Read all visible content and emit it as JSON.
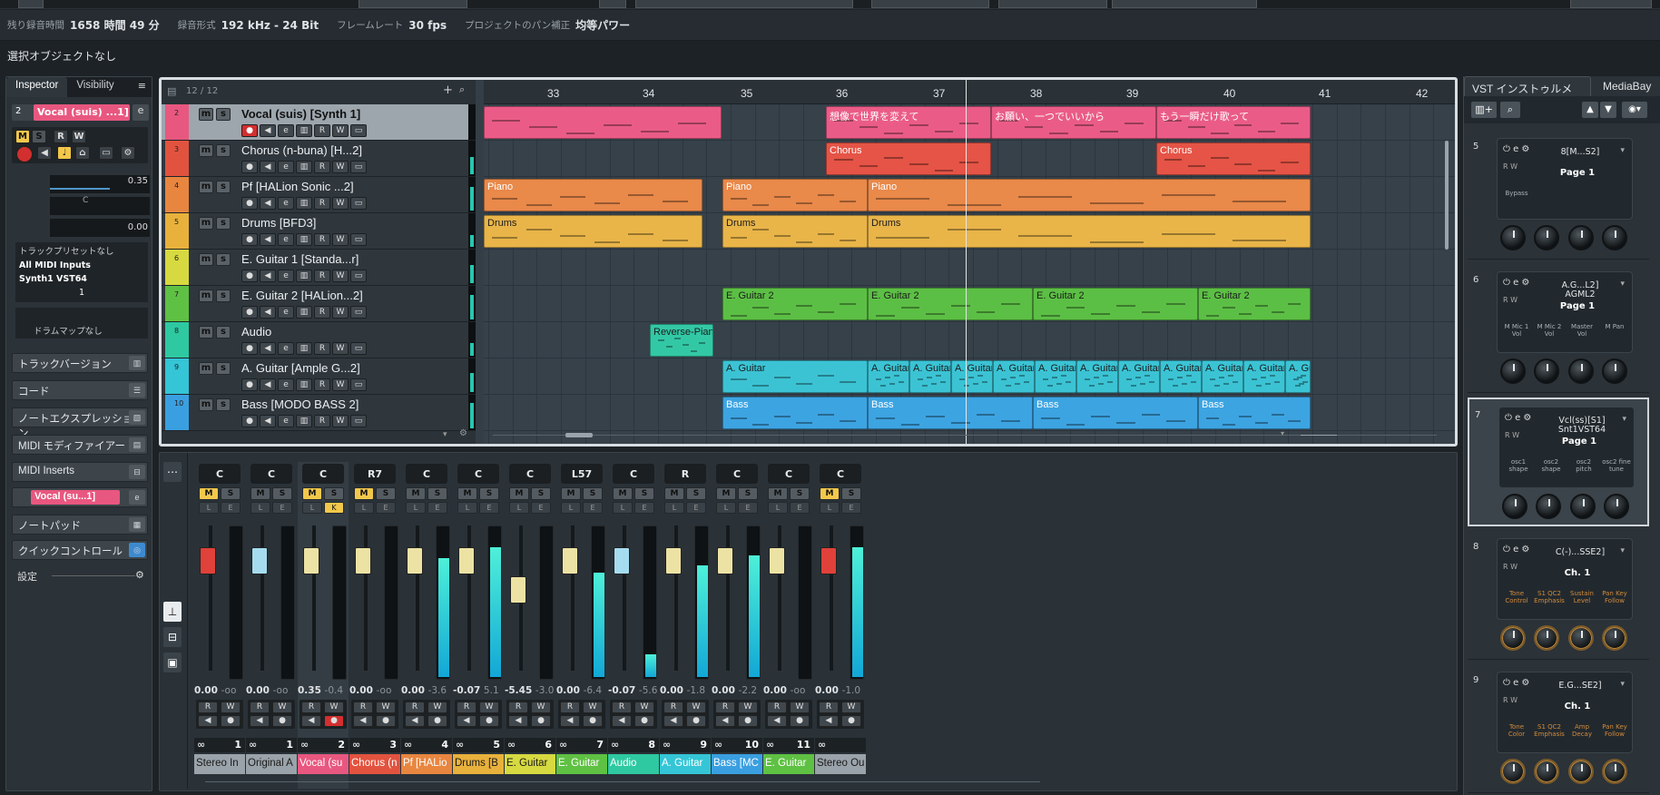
{
  "status": {
    "rec_time_label": "残り録音時間",
    "rec_time": "1658 時間 49 分",
    "rec_format_label": "録音形式",
    "rec_format": "192 kHz - 24 Bit",
    "frame_rate_label": "フレームレート",
    "frame_rate": "30 fps",
    "pan_label": "プロジェクトのパン補正",
    "pan_value": "均等パワー"
  },
  "selection_info": "選択オブジェクトなし",
  "inspector": {
    "tabs": [
      "Inspector",
      "Visibility"
    ],
    "track_name": "Vocal (suis) ...1]",
    "volume": "0.35",
    "pan": "C",
    "pan_val": "0.00",
    "preset": "トラックプリセットなし",
    "midi_in": "All MIDI Inputs",
    "midi_out": "Synth1 VST64",
    "channel": "1",
    "drum_map": "ドラムマップなし",
    "sections": [
      "トラックバージョン",
      "コード",
      "ノートエクスプレッション",
      "MIDI モディファイアー",
      "MIDI Inserts",
      "ノートパッド",
      "クイックコントロール"
    ],
    "sel_track_name": "Vocal (su...1]",
    "settings": "設定"
  },
  "project": {
    "track_count": "12 / 12",
    "tracks": [
      {
        "num": "2",
        "name": "Vocal (suis) [Synth 1]",
        "color": "#e8577f"
      },
      {
        "num": "3",
        "name": "Chorus (n-buna) [H...2]",
        "color": "#e2533f"
      },
      {
        "num": "4",
        "name": "Pf [HALion Sonic ...2]",
        "color": "#e88640"
      },
      {
        "num": "5",
        "name": "Drums [BFD3]",
        "color": "#e8b13c"
      },
      {
        "num": "6",
        "name": "E. Guitar 1 [Standa...r]",
        "color": "#d7d940"
      },
      {
        "num": "7",
        "name": "E. Guitar 2 [HALion...2]",
        "color": "#5fc143"
      },
      {
        "num": "8",
        "name": "Audio",
        "color": "#2ec9a1"
      },
      {
        "num": "9",
        "name": "A. Guitar [Ample G...2]",
        "color": "#34c5d6"
      },
      {
        "num": "10",
        "name": "Bass [MODO BASS 2]",
        "color": "#3a9fe0"
      }
    ],
    "bars": [
      "33",
      "34",
      "35",
      "36",
      "37",
      "38",
      "39",
      "40",
      "41",
      "42"
    ],
    "parts": {
      "vocal": [
        "想像で世界を変えて",
        "お願い、一つでいいから",
        "もう一瞬だけ歌って"
      ],
      "chorus": "Chorus",
      "piano": "Piano",
      "drums": "Drums",
      "eg2": "E. Guitar 2",
      "audio": "Reverse-Piano",
      "aguitar": "A. Guitar",
      "bass": "Bass"
    }
  },
  "mixer": {
    "channels": [
      {
        "pan": "C",
        "vol": "0.00",
        "peak": "-oo",
        "num": "1",
        "name": "Stereo In",
        "color": "#9aa3aa"
      },
      {
        "pan": "C",
        "vol": "0.00",
        "peak": "-oo",
        "num": "1",
        "name": "Original A",
        "color": "#9aa3aa"
      },
      {
        "pan": "C",
        "vol": "0.35",
        "peak": "-0.4",
        "num": "2",
        "name": "Vocal (su",
        "color": "#e8577f"
      },
      {
        "pan": "R7",
        "vol": "0.00",
        "peak": "-oo",
        "num": "3",
        "name": "Chorus (n",
        "color": "#e2533f"
      },
      {
        "pan": "C",
        "vol": "0.00",
        "peak": "-3.6",
        "num": "4",
        "name": "Pf [HALio",
        "color": "#e88640"
      },
      {
        "pan": "C",
        "vol": "-0.07",
        "peak": "5.1",
        "num": "5",
        "name": "Drums [B",
        "color": "#e8b13c"
      },
      {
        "pan": "C",
        "vol": "-5.45",
        "peak": "-3.0",
        "num": "6",
        "name": "E. Guitar",
        "color": "#d7d940"
      },
      {
        "pan": "L57",
        "vol": "0.00",
        "peak": "-6.4",
        "num": "7",
        "name": "E. Guitar",
        "color": "#5fc143"
      },
      {
        "pan": "C",
        "vol": "-0.07",
        "peak": "-5.6",
        "num": "8",
        "name": "Audio",
        "color": "#2ec9a1"
      },
      {
        "pan": "R",
        "vol": "0.00",
        "peak": "-1.8",
        "num": "9",
        "name": "A. Guitar",
        "color": "#34c5d6"
      },
      {
        "pan": "C",
        "vol": "0.00",
        "peak": "-2.2",
        "num": "10",
        "name": "Bass [MC",
        "color": "#3a9fe0"
      },
      {
        "pan": "C",
        "vol": "0.00",
        "peak": "-oo",
        "num": "11",
        "name": "E. Guitar",
        "color": "#5fc143"
      },
      {
        "pan": "C",
        "vol": "0.00",
        "peak": "-1.0",
        "num": "",
        "name": "Stereo Ou",
        "color": "#9aa3aa"
      }
    ]
  },
  "vsti": {
    "tabs": [
      "VST インストゥルメント",
      "MediaBay"
    ],
    "slots": [
      {
        "num": "5",
        "name": "8[M...S2]",
        "page": "Page 1",
        "labels": [
          "Bypass"
        ]
      },
      {
        "num": "6",
        "name": "A.G...L2] AGML2",
        "page": "Page 1",
        "labels": [
          "M Mic 1 Vol",
          "M Mic 2 Vol",
          "Master Vol",
          "M Pan"
        ]
      },
      {
        "num": "7",
        "name": "Vcl(ss)[S1] Snt1VST64",
        "page": "Page 1",
        "labels": [
          "osc1 shape",
          "osc2 shape",
          "osc2 pitch",
          "osc2 fine tune"
        ]
      },
      {
        "num": "8",
        "name": "C(-)...SSE2]",
        "page": "Ch. 1",
        "labels": [
          "Tone Control",
          "S1 QC2 Emphasis",
          "Sustain Level",
          "Pan Key Follow"
        ]
      },
      {
        "num": "9",
        "name": "E.G...SE2]",
        "page": "Ch. 1",
        "labels": [
          "Tone Color",
          "S1 QC2 Emphasis",
          "Amp Decay",
          "Pan Key Follow"
        ]
      }
    ]
  }
}
